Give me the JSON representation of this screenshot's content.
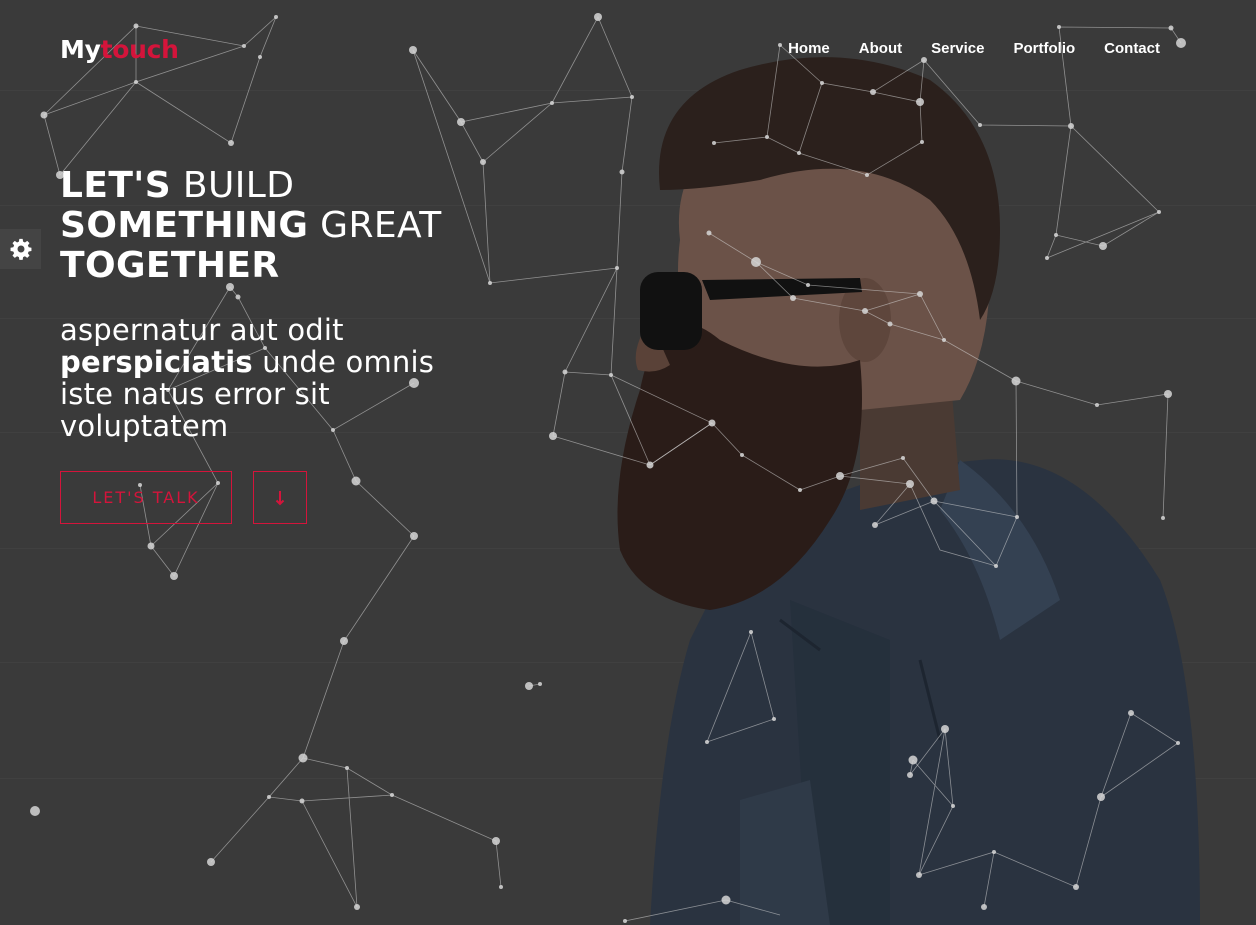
{
  "brand": {
    "name_main": "My",
    "name_accent": "touch"
  },
  "nav": {
    "items": [
      "Home",
      "About",
      "Service",
      "Portfolio",
      "Contact"
    ]
  },
  "hero": {
    "headline": {
      "line1_bold": "LET'S",
      "line1_rest": " BUILD",
      "line2_bold": "SOMETHING",
      "line2_rest": " GREAT",
      "line3_bold": "TOGETHER"
    },
    "subtitle": {
      "part1": "aspernatur aut odit ",
      "part2_bold": "perspiciatis",
      "part3": " unde omnis iste natus error sit voluptatem"
    },
    "cta_label": "LET'S TALK"
  },
  "icons": {
    "settings": "gear-icon",
    "scroll_down": "arrow-down-icon"
  },
  "colors": {
    "background": "#3a3a3a",
    "accent": "#d4143b",
    "text": "#ffffff",
    "network": "#d8d8d8"
  }
}
